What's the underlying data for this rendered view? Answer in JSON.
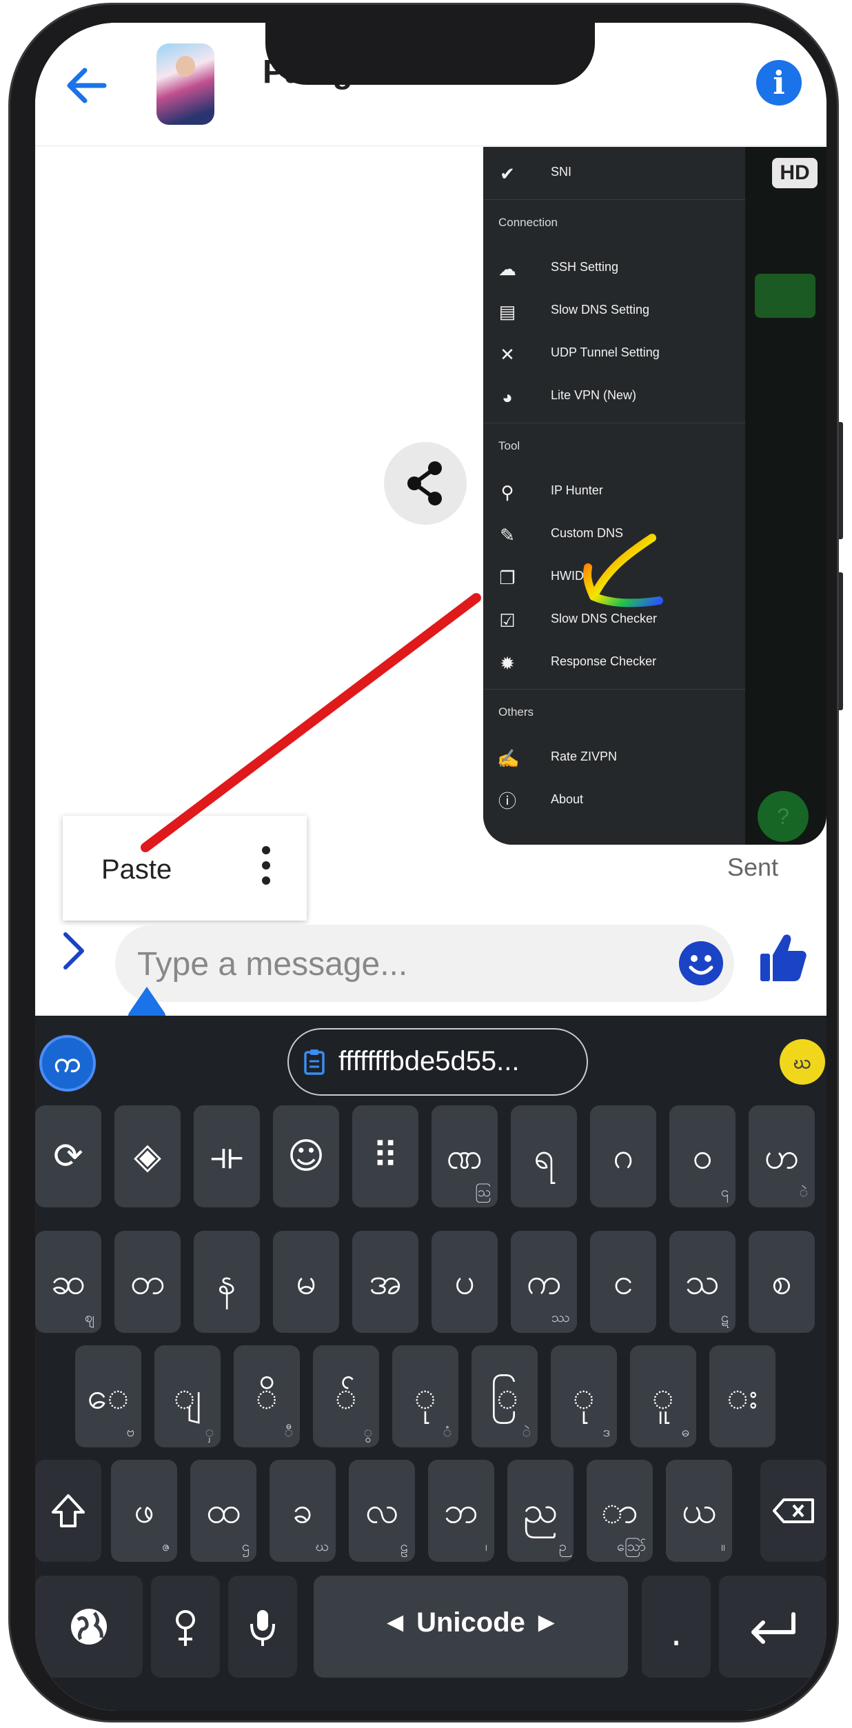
{
  "header": {
    "contact_name": "Paing",
    "back_icon": "arrow-left-icon",
    "info_icon": "info-icon",
    "info_glyph": "i"
  },
  "share_icon": "share-icon",
  "vpn_menu": {
    "badge": "HD",
    "items_top": [
      {
        "icon": "check-badge-icon",
        "label": "SNI"
      }
    ],
    "sections": [
      {
        "title": "Connection",
        "items": [
          {
            "icon": "cloud-icon",
            "label": "SSH Setting"
          },
          {
            "icon": "server-icon",
            "label": "Slow DNS Setting"
          },
          {
            "icon": "tools-icon",
            "label": "UDP Tunnel Setting"
          },
          {
            "icon": "globe-shield-icon",
            "label": "Lite VPN (New)"
          }
        ]
      },
      {
        "title": "Tool",
        "items": [
          {
            "icon": "search-icon",
            "label": "IP Hunter"
          },
          {
            "icon": "pencil-icon",
            "label": "Custom DNS"
          },
          {
            "icon": "copy-icon",
            "label": "HWID"
          },
          {
            "icon": "checklist-icon",
            "label": "Slow DNS Checker"
          },
          {
            "icon": "bug-icon",
            "label": "Response Checker"
          }
        ]
      },
      {
        "title": "Others",
        "items": [
          {
            "icon": "rate-icon",
            "label": "Rate ZIVPN"
          },
          {
            "icon": "info-icon",
            "label": "About"
          }
        ]
      }
    ],
    "help_glyph": "?"
  },
  "paste_popup": {
    "label": "Paste"
  },
  "status_text": "Sent",
  "composer": {
    "placeholder": "Type a message..."
  },
  "keyboard": {
    "logo_glyph": "က",
    "clipboard_text": "fffffffbde5d55...",
    "badge_glyph": "ဃ",
    "row1": [
      {
        "label": "⟳",
        "sub": ""
      },
      {
        "label": "◈",
        "sub": ""
      },
      {
        "label": "⟛",
        "sub": ""
      },
      {
        "label": "☺",
        "sub": ""
      },
      {
        "label": "⠿",
        "sub": ""
      },
      {
        "label": "ဏ",
        "sub": "ဩ"
      },
      {
        "label": "ရ",
        "sub": ""
      },
      {
        "label": "ဂ",
        "sub": ""
      },
      {
        "label": "ဝ",
        "sub": "၎"
      },
      {
        "label": "ဟ",
        "sub": "ဲ"
      }
    ],
    "row2": [
      {
        "label": "ဆ",
        "sub": "ဈ"
      },
      {
        "label": "တ",
        "sub": ""
      },
      {
        "label": "န",
        "sub": ""
      },
      {
        "label": "မ",
        "sub": ""
      },
      {
        "label": "အ",
        "sub": ""
      },
      {
        "label": "ပ",
        "sub": ""
      },
      {
        "label": "က",
        "sub": "ဿ"
      },
      {
        "label": "င",
        "sub": ""
      },
      {
        "label": "သ",
        "sub": "ဋ"
      },
      {
        "label": "စ",
        "sub": ""
      }
    ],
    "row3": [
      {
        "label": "ေ",
        "sub": "ဗ"
      },
      {
        "label": "ျ",
        "sub": "ှ"
      },
      {
        "label": "ိ",
        "sub": "ီ"
      },
      {
        "label": "်",
        "sub": "ွ"
      },
      {
        "label": "ု",
        "sub": "ံ"
      },
      {
        "label": "ြ",
        "sub": "ဲ"
      },
      {
        "label": "ု",
        "sub": "ဒ"
      },
      {
        "label": "ူ",
        "sub": "ဓ"
      },
      {
        "label": "း",
        "sub": ""
      }
    ],
    "row4": [
      {
        "label": "ဖ",
        "sub": "ဇ"
      },
      {
        "label": "ထ",
        "sub": "ဌ"
      },
      {
        "label": "ခ",
        "sub": "ဃ"
      },
      {
        "label": "လ",
        "sub": "ဠ"
      },
      {
        "label": "ဘ",
        "sub": "၊"
      },
      {
        "label": "ည",
        "sub": "ဉ"
      },
      {
        "label": "ာ",
        "sub": "ဪ"
      },
      {
        "label": "ယ",
        "sub": "။"
      }
    ],
    "space_label": "◄ Unicode ►",
    "dot_label": ".",
    "icons": {
      "shift": "shift-icon",
      "backspace": "backspace-icon",
      "globe": "globe-icon",
      "gender": "gender-icon",
      "mic": "mic-icon",
      "enter": "enter-icon"
    }
  },
  "colors": {
    "accent": "#1a73e8",
    "annotation_red": "#e0191b",
    "keyboard_bg": "#1e2227",
    "key_bg": "#3a3e45",
    "drawer_bg": "#25282a"
  }
}
